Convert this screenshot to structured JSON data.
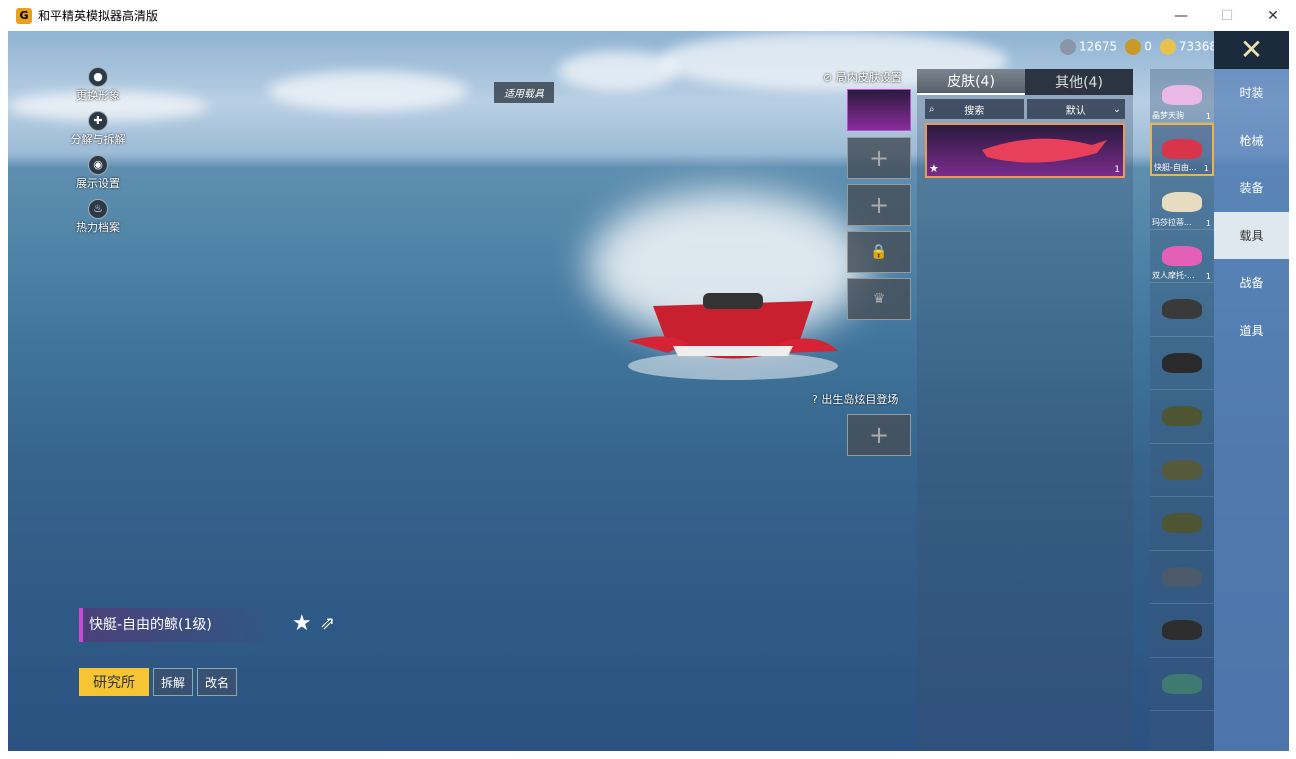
{
  "window": {
    "title": "和平精英模拟器高清版",
    "minimize": "—",
    "maximize": "☐",
    "close": "✕"
  },
  "currency": [
    {
      "name": "silver-coin",
      "value": "12675",
      "color": "#8a96a8"
    },
    {
      "name": "token",
      "value": "0",
      "color": "#c79a2a"
    },
    {
      "name": "gold-coin",
      "value": "73368",
      "color": "#e8c24a"
    }
  ],
  "left_menu": [
    {
      "label": "更换形象",
      "icon": "person-icon"
    },
    {
      "label": "分解与拆解",
      "icon": "puzzle-icon"
    },
    {
      "label": "展示设置",
      "icon": "eye-icon"
    },
    {
      "label": "热力档案",
      "icon": "fire-icon"
    }
  ],
  "applicable_tag": "适用载具",
  "slots": {
    "ingame_label": "局内皮肤设置",
    "spawn_label": "出生岛炫目登场",
    "plus": "+"
  },
  "skin_panel": {
    "tabs": [
      "皮肤(4)",
      "其他(4)"
    ],
    "search": "搜索",
    "sort": "默认",
    "card_count": "1"
  },
  "vehicles": [
    {
      "name": "晶梦天驹",
      "count": "1",
      "color": "#e9b8e4"
    },
    {
      "name": "快艇-自由...",
      "count": "1",
      "color": "#d8344a"
    },
    {
      "name": "玛莎拉蒂...",
      "count": "1",
      "color": "#e8dcc0"
    },
    {
      "name": "双人摩托-...",
      "count": "1",
      "color": "#e45fb8"
    },
    {
      "name": "",
      "count": "",
      "color": "#3a3a3a"
    },
    {
      "name": "",
      "count": "",
      "color": "#2a2a2a"
    },
    {
      "name": "",
      "count": "",
      "color": "#4d5533"
    },
    {
      "name": "",
      "count": "",
      "color": "#555a3c"
    },
    {
      "name": "",
      "count": "",
      "color": "#4d5533"
    },
    {
      "name": "",
      "count": "",
      "color": "#4a5a6a"
    },
    {
      "name": "",
      "count": "",
      "color": "#2e2e2e"
    },
    {
      "name": "",
      "count": "",
      "color": "#3f7a70"
    }
  ],
  "categories": [
    "时装",
    "枪械",
    "装备",
    "载具",
    "战备",
    "道具"
  ],
  "active_category": "载具",
  "vehicle_title": "快艇-自由的鲸(1级)",
  "buttons": {
    "research": "研究所",
    "dismantle": "拆解",
    "rename": "改名"
  },
  "close_icon": "✕"
}
